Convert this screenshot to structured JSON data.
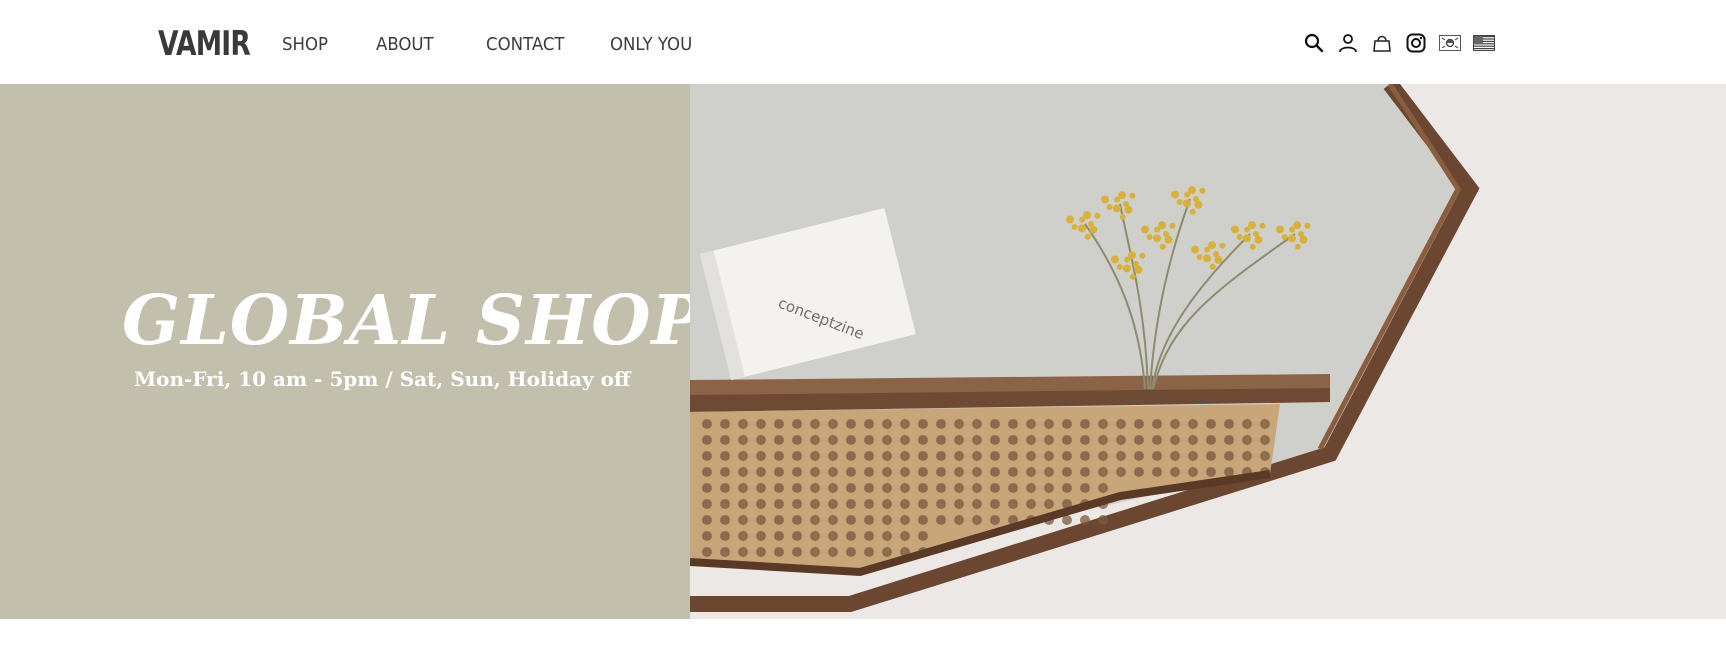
{
  "header": {
    "logo": "VAMIR",
    "nav": [
      "SHOP",
      "ABOUT",
      "CONTACT",
      "ONLY YOU"
    ],
    "icons": [
      "search-icon",
      "user-icon",
      "bag-icon",
      "instagram-icon",
      "korean-flag-icon",
      "us-flag-icon"
    ]
  },
  "hero": {
    "title": "GLOBAL SHOP",
    "subtitle": "Mon-Fri, 10 am - 5pm / Sat, Sun, Holiday off",
    "image": {
      "book_text": "conceptzine"
    },
    "colors": {
      "left_panel": "#c2c0ad",
      "wall": "#ebe8e5",
      "mirror": "#cfd0cc",
      "frame": "#6b4630",
      "rattan": "#c9a67a",
      "flowers": "#d8b13a"
    }
  }
}
